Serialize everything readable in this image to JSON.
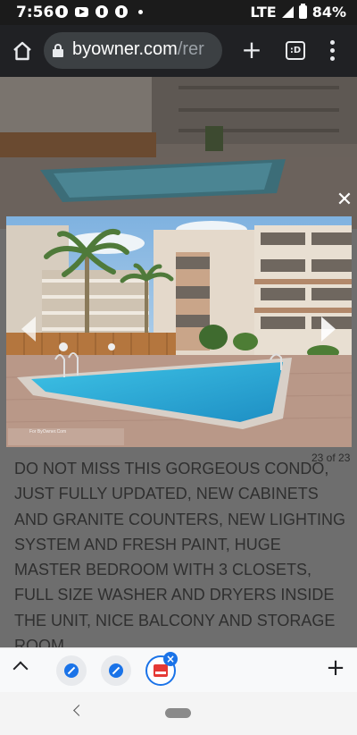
{
  "status_bar": {
    "time": "7:56",
    "network": "LTE",
    "battery": "84%",
    "notification_icons": [
      "pinterest-icon",
      "youtube-icon",
      "pinterest-icon",
      "pinterest-icon"
    ]
  },
  "browser": {
    "url_domain": "byowner.com",
    "url_path": "/rer",
    "tab_count_label": ":D"
  },
  "viewer": {
    "counter": "23 of 23",
    "watermark": "For ByOwner.Com"
  },
  "listing": {
    "description": "DO NOT MISS THIS GORGEOUS CONDO, JUST FULLY UPDATED, NEW CABINETS AND GRANITE COUNTERS, NEW LIGHTING SYSTEM AND FRESH PAINT, HUGE MASTER BEDROOM WITH 3 CLOSETS, FULL SIZE WASHER AND DRYERS INSIDE THE UNIT, NICE BALCONY AND STORAGE ROOM"
  },
  "colors": {
    "toolbar": "#202124",
    "accent": "#1a73e8",
    "overlay": "#6e6e6e"
  }
}
